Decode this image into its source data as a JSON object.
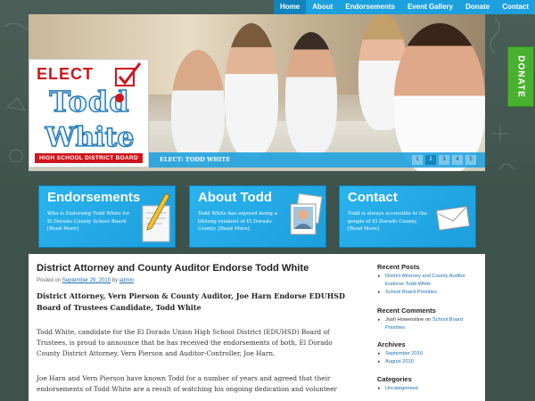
{
  "nav": {
    "items": [
      {
        "label": "Home",
        "active": true
      },
      {
        "label": "About",
        "active": false
      },
      {
        "label": "Endorsements",
        "active": false
      },
      {
        "label": "Event Gallery",
        "active": false
      },
      {
        "label": "Donate",
        "active": false
      },
      {
        "label": "Contact",
        "active": false
      }
    ]
  },
  "logo": {
    "elect": "ELECT",
    "first": "Todd",
    "last": "White",
    "tagline": "HIGH SCHOOL DISTRICT BOARD"
  },
  "slider": {
    "caption": "ELECT: TODD WHITE",
    "pages": [
      "1",
      "2",
      "3",
      "4",
      "5"
    ],
    "current": 2
  },
  "donate_tab": "DONATE",
  "features": [
    {
      "title": "Endorsements",
      "text": "Who is Endorsing Todd White for El Dorado County School Board [Read More]"
    },
    {
      "title": "About Todd",
      "text": "Todd White has enjoyed being a lifelong resident of El Dorado County. [Read More]"
    },
    {
      "title": "Contact",
      "text": "Todd is always accessible to the people of El Dorado County. [Read More]"
    }
  ],
  "post": {
    "title": "District Attorney and County Auditor Endorse Todd White",
    "meta_prefix": "Posted on",
    "date": "September 29, 2010",
    "meta_by": "by",
    "author": "admin",
    "lead": "District Attorney, Vern Pierson & County Auditor, Joe Harn Endorse EDUHSD Board of Trustees Candidate, Todd White",
    "p1": "Todd White, candidate for the El Dorado Union High School District (EDUHSD) Board of Trustees, is proud to announce that he has received the endorsements of both, El Dorado County District Attorney, Vern Pierson and Auditor-Controller, Joe Harn.",
    "p2": "Joe Harn and Vern Pierson have known Todd for a number of years and agreed that their endorsements of Todd White are a result of watching his ongoing dedication and volunteer"
  },
  "sidebar": {
    "recent_posts": {
      "heading": "Recent Posts",
      "items": [
        "District Attorney and County Auditor Endorse Todd White",
        "School Board Priorities"
      ]
    },
    "recent_comments": {
      "heading": "Recent Comments",
      "author": "Josh Howenstine",
      "on": "on",
      "target": "School Board Priorities"
    },
    "archives": {
      "heading": "Archives",
      "items": [
        "September 2010",
        "August 2010"
      ]
    },
    "categories": {
      "heading": "Categories",
      "items": [
        "Uncategorized"
      ]
    }
  },
  "colors": {
    "accent": "#1ca0de",
    "chalkboard": "#3c524a",
    "elect_red": "#d0141c",
    "donate_green": "#4ab02f",
    "link": "#1b6fb3"
  }
}
